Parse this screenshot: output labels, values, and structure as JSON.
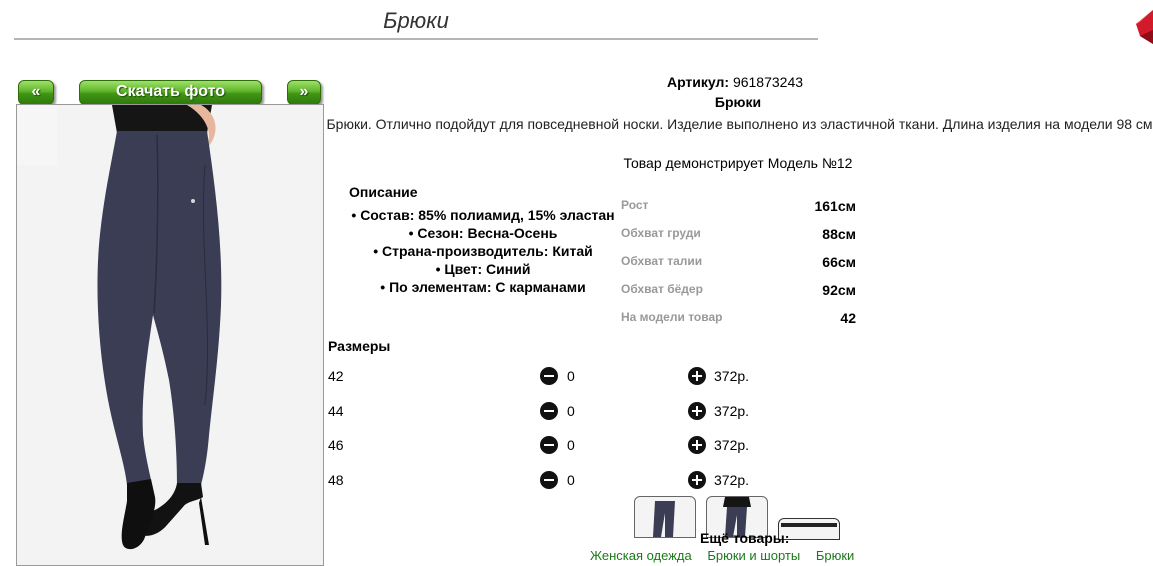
{
  "page": {
    "title": "Брюки"
  },
  "gallery": {
    "prev_label": "«",
    "download_label": "Скачать фото",
    "next_label": "»"
  },
  "product": {
    "article_label": "Артикул:",
    "article_value": "961873243",
    "name": "Брюки",
    "description": "Брюки. Отлично подойдут для повседневной носки. Изделие выполнено из эластичной ткани. Длина изделия на модели 98 см",
    "model_text": "Товар демонстрирует Модель №12"
  },
  "description_block": {
    "heading": "Описание",
    "items": [
      "Состав: 85% полиамид, 15% эластан",
      "Сезон: Весна-Осень",
      "Страна-производитель: Китай",
      "Цвет: Синий",
      "По элементам: С карманами"
    ]
  },
  "measurements": [
    {
      "label": "Рост",
      "value": "161см"
    },
    {
      "label": "Обхват груди",
      "value": "88см"
    },
    {
      "label": "Обхват талии",
      "value": "66см"
    },
    {
      "label": "Обхват бёдер",
      "value": "92см"
    },
    {
      "label": "На модели товар",
      "value": "42"
    }
  ],
  "sizes": {
    "heading": "Размеры",
    "rows": [
      {
        "size": "42",
        "qty": "0",
        "price": "372р."
      },
      {
        "size": "44",
        "qty": "0",
        "price": "372р."
      },
      {
        "size": "46",
        "qty": "0",
        "price": "372р."
      },
      {
        "size": "48",
        "qty": "0",
        "price": "372р."
      }
    ]
  },
  "more": {
    "heading": "Ещё товары:",
    "links": [
      "Женская одежда",
      "Брюки и шорты",
      "Брюки"
    ]
  },
  "colors": {
    "button_green": "#4fa51f",
    "pants": "#3a3d54",
    "link_green": "#1a7a1a",
    "corner_red": "#d11a2a"
  },
  "icons": {
    "corner": "red-cube-icon",
    "minus": "minus-circle-icon",
    "plus": "plus-circle-icon"
  }
}
